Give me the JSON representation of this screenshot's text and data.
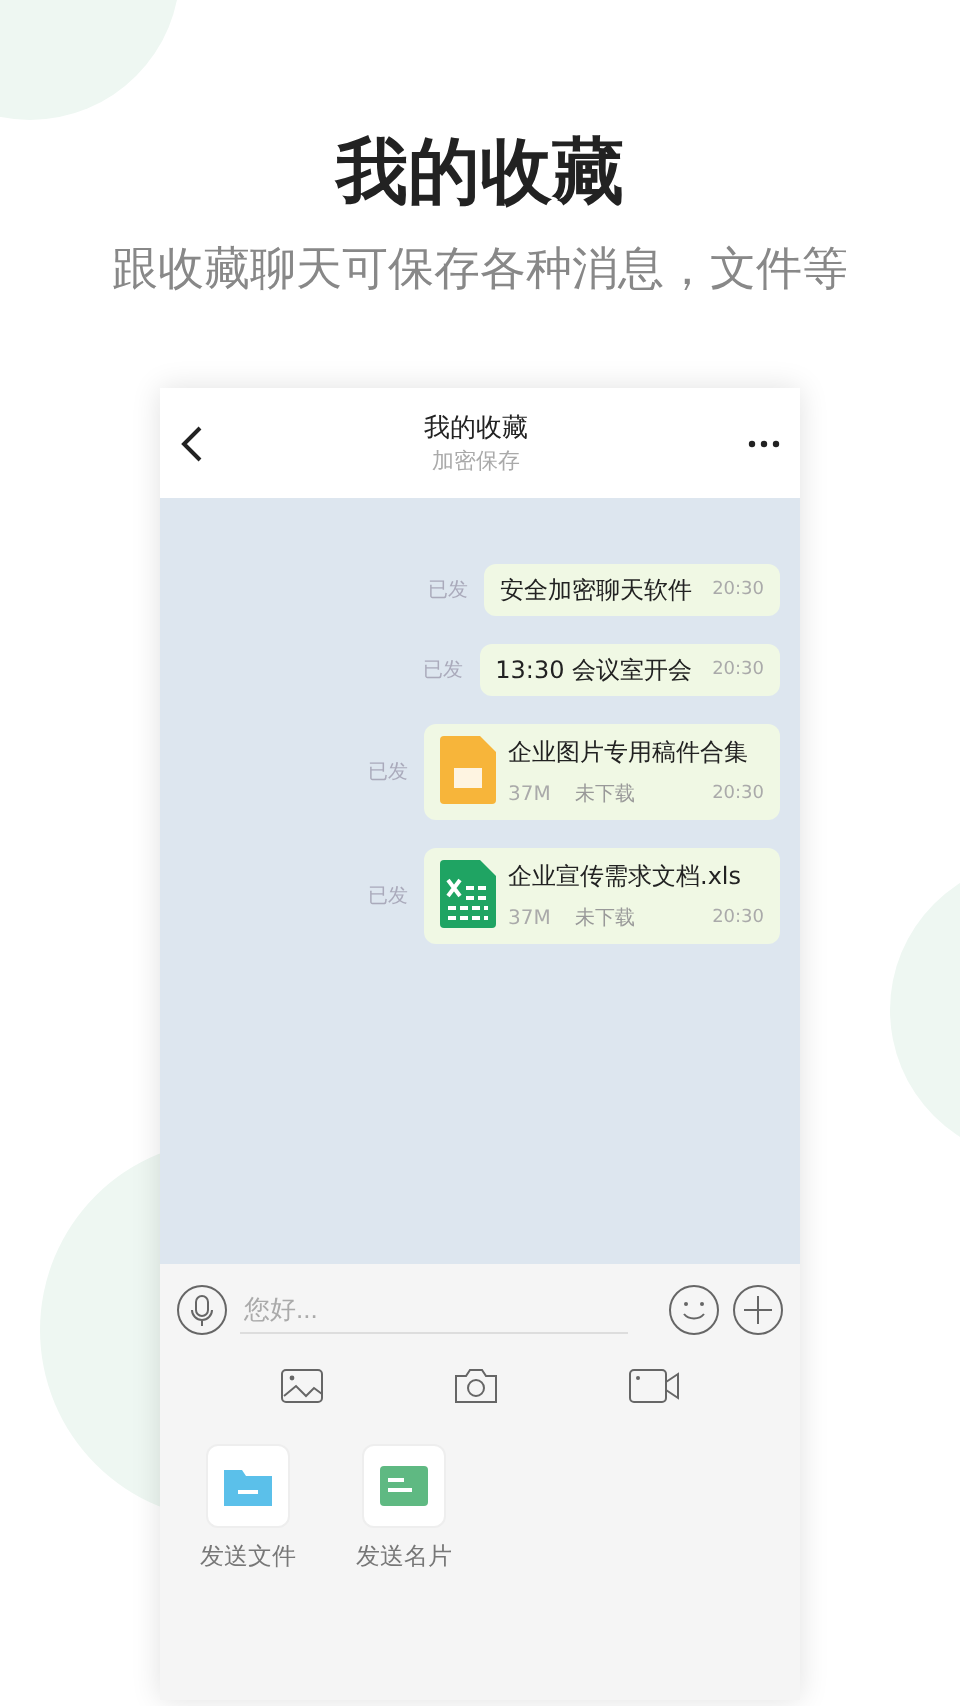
{
  "headline": {
    "title": "我的收藏",
    "subtitle": "跟收藏聊天可保存各种消息，文件等"
  },
  "header": {
    "title": "我的收藏",
    "subtitle": "加密保存"
  },
  "messages": [
    {
      "kind": "text",
      "status": "已发",
      "text": "安全加密聊天软件",
      "time": "20:30"
    },
    {
      "kind": "text",
      "status": "已发",
      "text": "13:30 会议室开会",
      "time": "20:30"
    },
    {
      "kind": "document",
      "status": "已发",
      "text": "企业图片专用稿件合集",
      "size": "37M",
      "download": "未下载",
      "time": "20:30"
    },
    {
      "kind": "spreadsheet",
      "status": "已发",
      "text": "企业宣传需求文档.xls",
      "size": "37M",
      "download": "未下载",
      "time": "20:30"
    }
  ],
  "input": {
    "placeholder": "您好..."
  },
  "actions": [
    {
      "kind": "folder",
      "label": "发送文件"
    },
    {
      "kind": "card",
      "label": "发送名片"
    }
  ]
}
